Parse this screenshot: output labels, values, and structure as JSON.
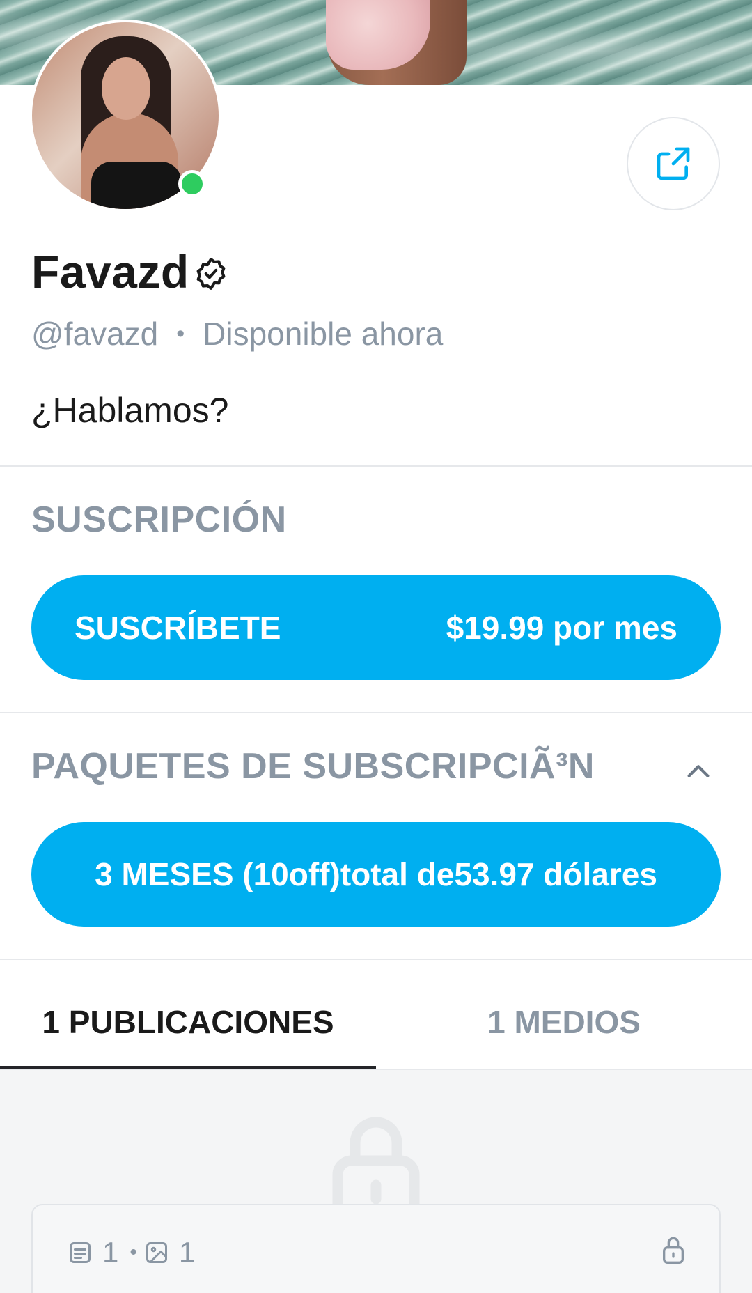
{
  "profile": {
    "name": "Favazd",
    "handle": "@favazd",
    "separator": "•",
    "availability": "Disponible ahora",
    "bio": "¿Hablamos?",
    "online": true
  },
  "subscription": {
    "section_title": "SUSCRIPCIÓN",
    "button_label": "SUSCRÍBETE",
    "price_label": "$19.99 por mes"
  },
  "bundles": {
    "section_title": "PAQUETES DE SUBSCRIPCIÃ³N",
    "expanded": true,
    "items": [
      {
        "label": "3 MESES (10off)total de53.97 dólares"
      }
    ]
  },
  "tabs": [
    {
      "label": "1 PUBLICACIONES",
      "active": true
    },
    {
      "label": "1 MEDIOS",
      "active": false
    }
  ],
  "post_card": {
    "text_count": "1",
    "separator": "•",
    "media_count": "1",
    "locked": true
  },
  "icons": {
    "share": "share-icon",
    "verified": "verified-badge-icon",
    "chevron": "chevron-up-icon",
    "lock": "lock-icon",
    "text_post": "text-post-icon",
    "image": "image-icon"
  },
  "colors": {
    "accent": "#00aff0",
    "online": "#2ecc5f",
    "muted": "#8a96a3",
    "text": "#1a1a1a"
  }
}
